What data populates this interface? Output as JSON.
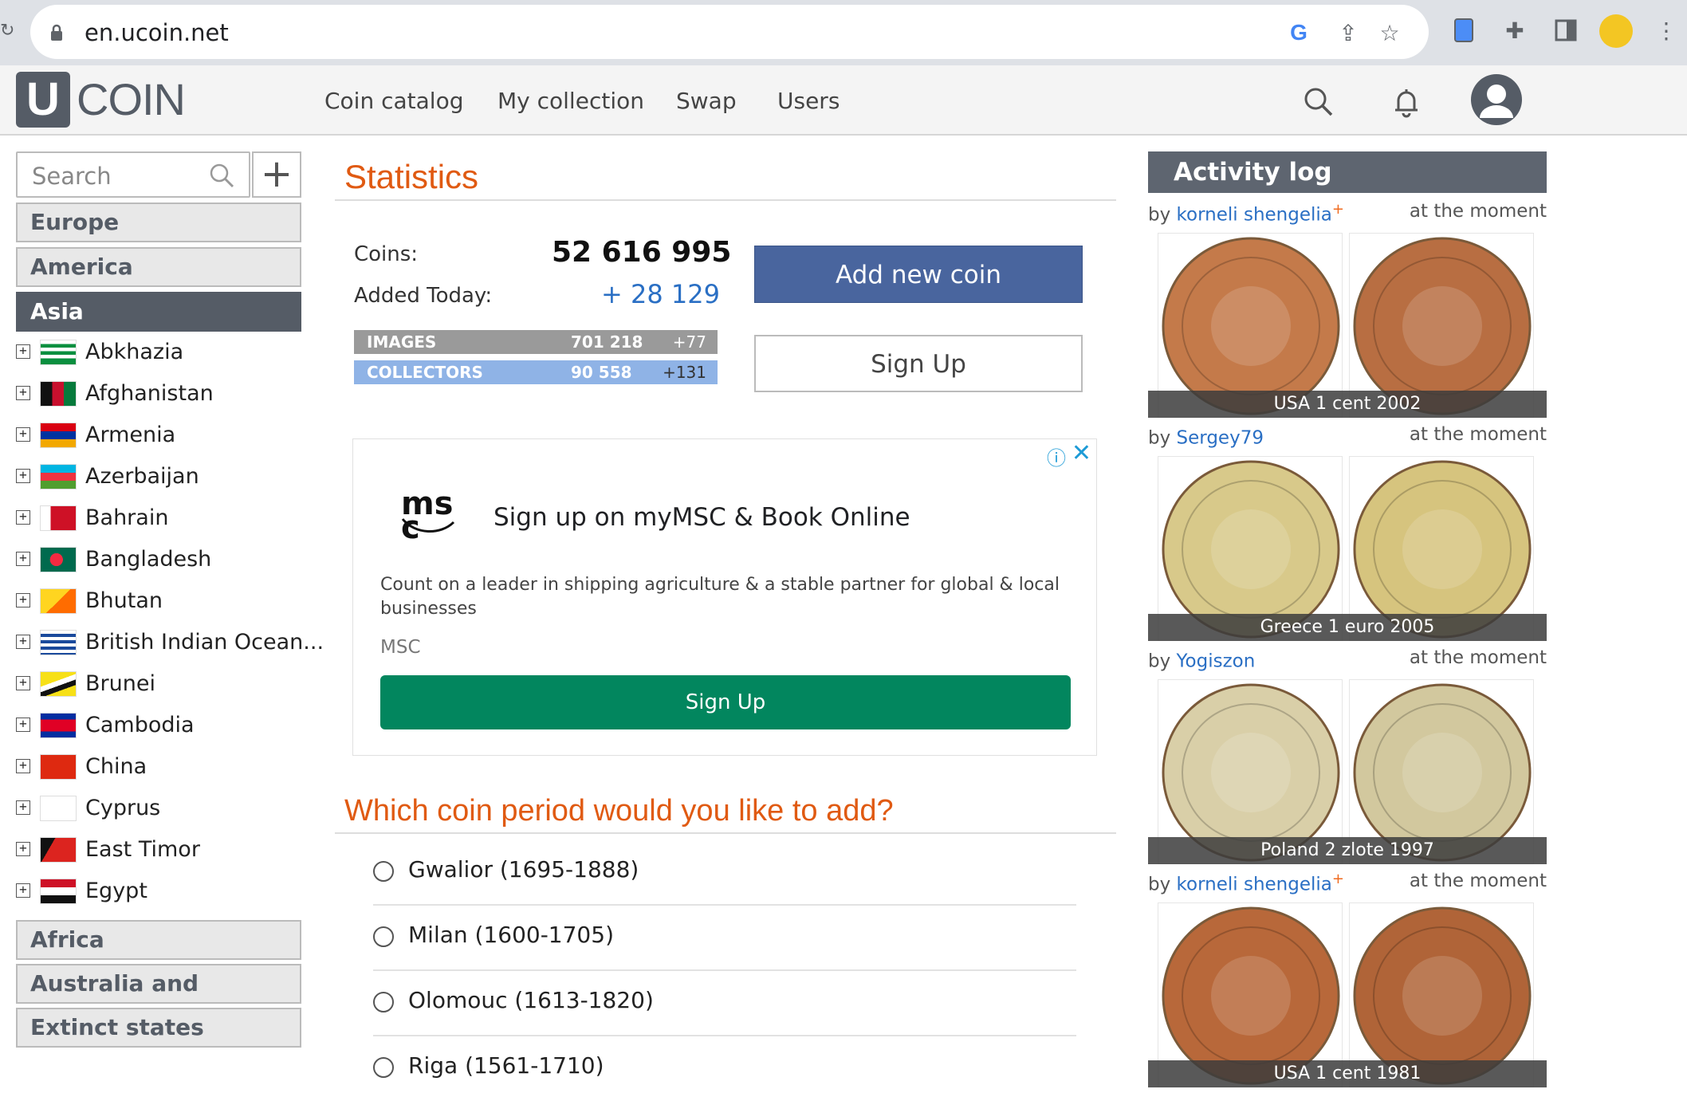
{
  "browser": {
    "url": "en.ucoin.net"
  },
  "header": {
    "logo_letter": "U",
    "logo_text": "COIN",
    "nav": [
      "Coin catalog",
      "My collection",
      "Swap",
      "Users"
    ]
  },
  "sidebar": {
    "search_placeholder": "Search",
    "plus_label": "+",
    "regions_top": [
      "Europe",
      "America",
      "Asia"
    ],
    "active_region": "Asia",
    "countries": [
      "Abkhazia",
      "Afghanistan",
      "Armenia",
      "Azerbaijan",
      "Bahrain",
      "Bangladesh",
      "Bhutan",
      "British Indian Ocean...",
      "Brunei",
      "Cambodia",
      "China",
      "Cyprus",
      "East Timor",
      "Egypt"
    ],
    "regions_bottom": [
      "Africa",
      "Australia and Oceania",
      "Extinct states"
    ],
    "expand_symbol": "+"
  },
  "stats": {
    "title": "Statistics",
    "coins_label": "Coins:",
    "coins_value": "52 616 995",
    "added_label": "Added Today:",
    "added_value": "+ 28 129",
    "images_label": "IMAGES",
    "images_value": "701 218",
    "images_delta": "+77",
    "collectors_label": "COLLECTORS",
    "collectors_value": "90 558",
    "collectors_delta": "+131",
    "add_coin_label": "Add new coin",
    "signup_label": "Sign Up"
  },
  "ad": {
    "logo_text": "msc",
    "title": "Sign up on myMSC & Book Online",
    "text": "Count on a leader in shipping agriculture & a stable partner for global & local businesses",
    "source": "MSC",
    "button": "Sign Up",
    "info_symbol": "ⓘ",
    "close_symbol": "✕"
  },
  "period": {
    "title": "Which coin period would you like to add?",
    "options": [
      "Gwalior (1695-1888)",
      "Milan (1600-1705)",
      "Olomouc (1613-1820)",
      "Riga (1561-1710)"
    ]
  },
  "activity": {
    "title": "Activity log",
    "by_label": "by",
    "entries": [
      {
        "user": "korneli shengelia",
        "plus": "+",
        "when": "at the moment",
        "caption": "USA 1 cent 2002",
        "colors": [
          "#c47a4a",
          "#b86e42"
        ]
      },
      {
        "user": "Sergey79",
        "plus": "",
        "when": "at the moment",
        "caption": "Greece 1 euro 2005",
        "colors": [
          "#d8c98a",
          "#d6c47e"
        ]
      },
      {
        "user": "Yogiszon",
        "plus": "",
        "when": "at the moment",
        "caption": "Poland 2 zlote 1997",
        "colors": [
          "#d9cfa8",
          "#d2c89e"
        ]
      },
      {
        "user": "korneli shengelia",
        "plus": "+",
        "when": "at the moment",
        "caption": "USA 1 cent 1981",
        "colors": [
          "#b8683a",
          "#b06438"
        ]
      }
    ]
  },
  "colors": {
    "accent_orange": "#e05a12",
    "header_slate": "#555c66",
    "button_blue": "#49659e",
    "link_blue": "#2a6fc4",
    "ad_green": "#02865e"
  }
}
